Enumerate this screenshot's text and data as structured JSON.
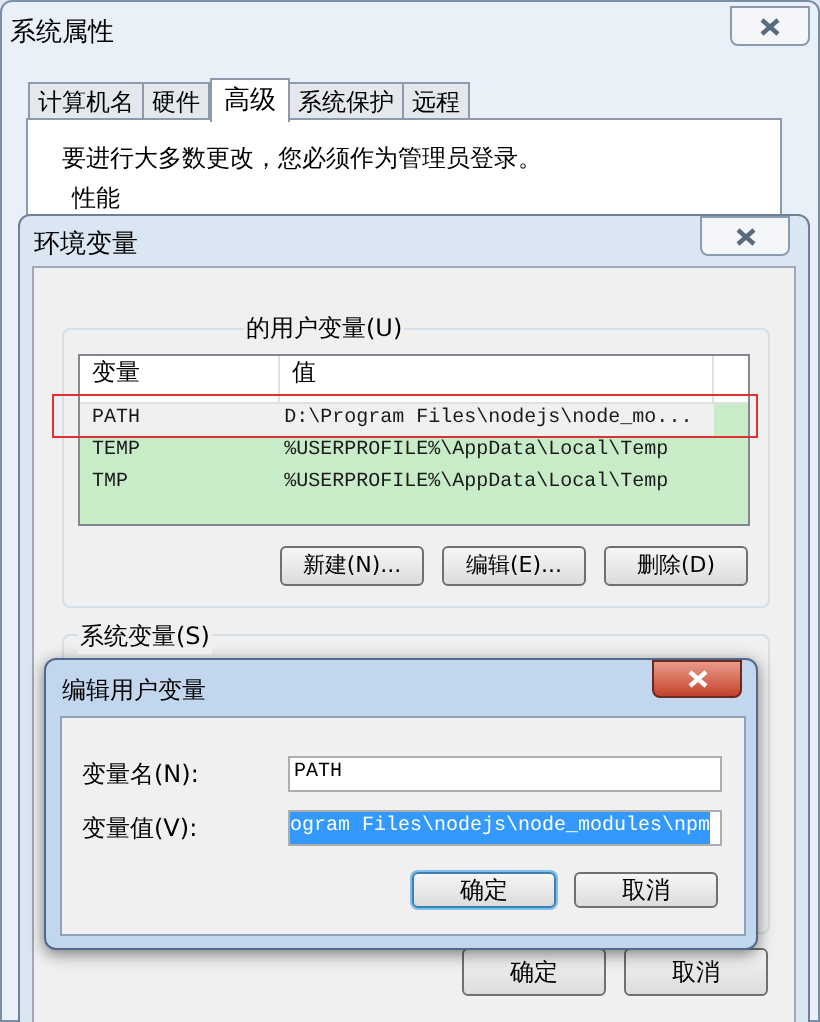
{
  "system_properties": {
    "title": "系统属性",
    "tabs": [
      {
        "label": "计算机名",
        "selected": false
      },
      {
        "label": "硬件",
        "selected": false
      },
      {
        "label": "高级",
        "selected": true
      },
      {
        "label": "系统保护",
        "selected": false
      },
      {
        "label": "远程",
        "selected": false
      }
    ],
    "notice": "要进行大多数更改，您必须作为管理员登录。",
    "group_label": "性能"
  },
  "environment_variables": {
    "title": "环境变量",
    "user_group_label": "的用户变量(U)",
    "columns": [
      "变量",
      "值"
    ],
    "rows": [
      {
        "name": "PATH",
        "value": "D:\\Program Files\\nodejs\\node_mo...",
        "highlighted": true
      },
      {
        "name": "TEMP",
        "value": "%USERPROFILE%\\AppData\\Local\\Temp",
        "highlighted": false
      },
      {
        "name": "TMP",
        "value": "%USERPROFILE%\\AppData\\Local\\Temp",
        "highlighted": false
      }
    ],
    "row_buttons": [
      "新建(N)...",
      "编辑(E)...",
      "删除(D)"
    ],
    "system_group_label": "系统变量(S)",
    "buttons": [
      "确定",
      "取消"
    ]
  },
  "edit_dialog": {
    "title": "编辑用户变量",
    "fields": [
      {
        "label": "变量名(N):",
        "value": "PATH",
        "selected": false
      },
      {
        "label": "变量值(V):",
        "value": "ogram Files\\nodejs\\node_modules\\npm",
        "selected": true
      }
    ],
    "buttons": [
      {
        "label": "确定",
        "default": true
      },
      {
        "label": "取消",
        "default": false
      }
    ]
  }
}
